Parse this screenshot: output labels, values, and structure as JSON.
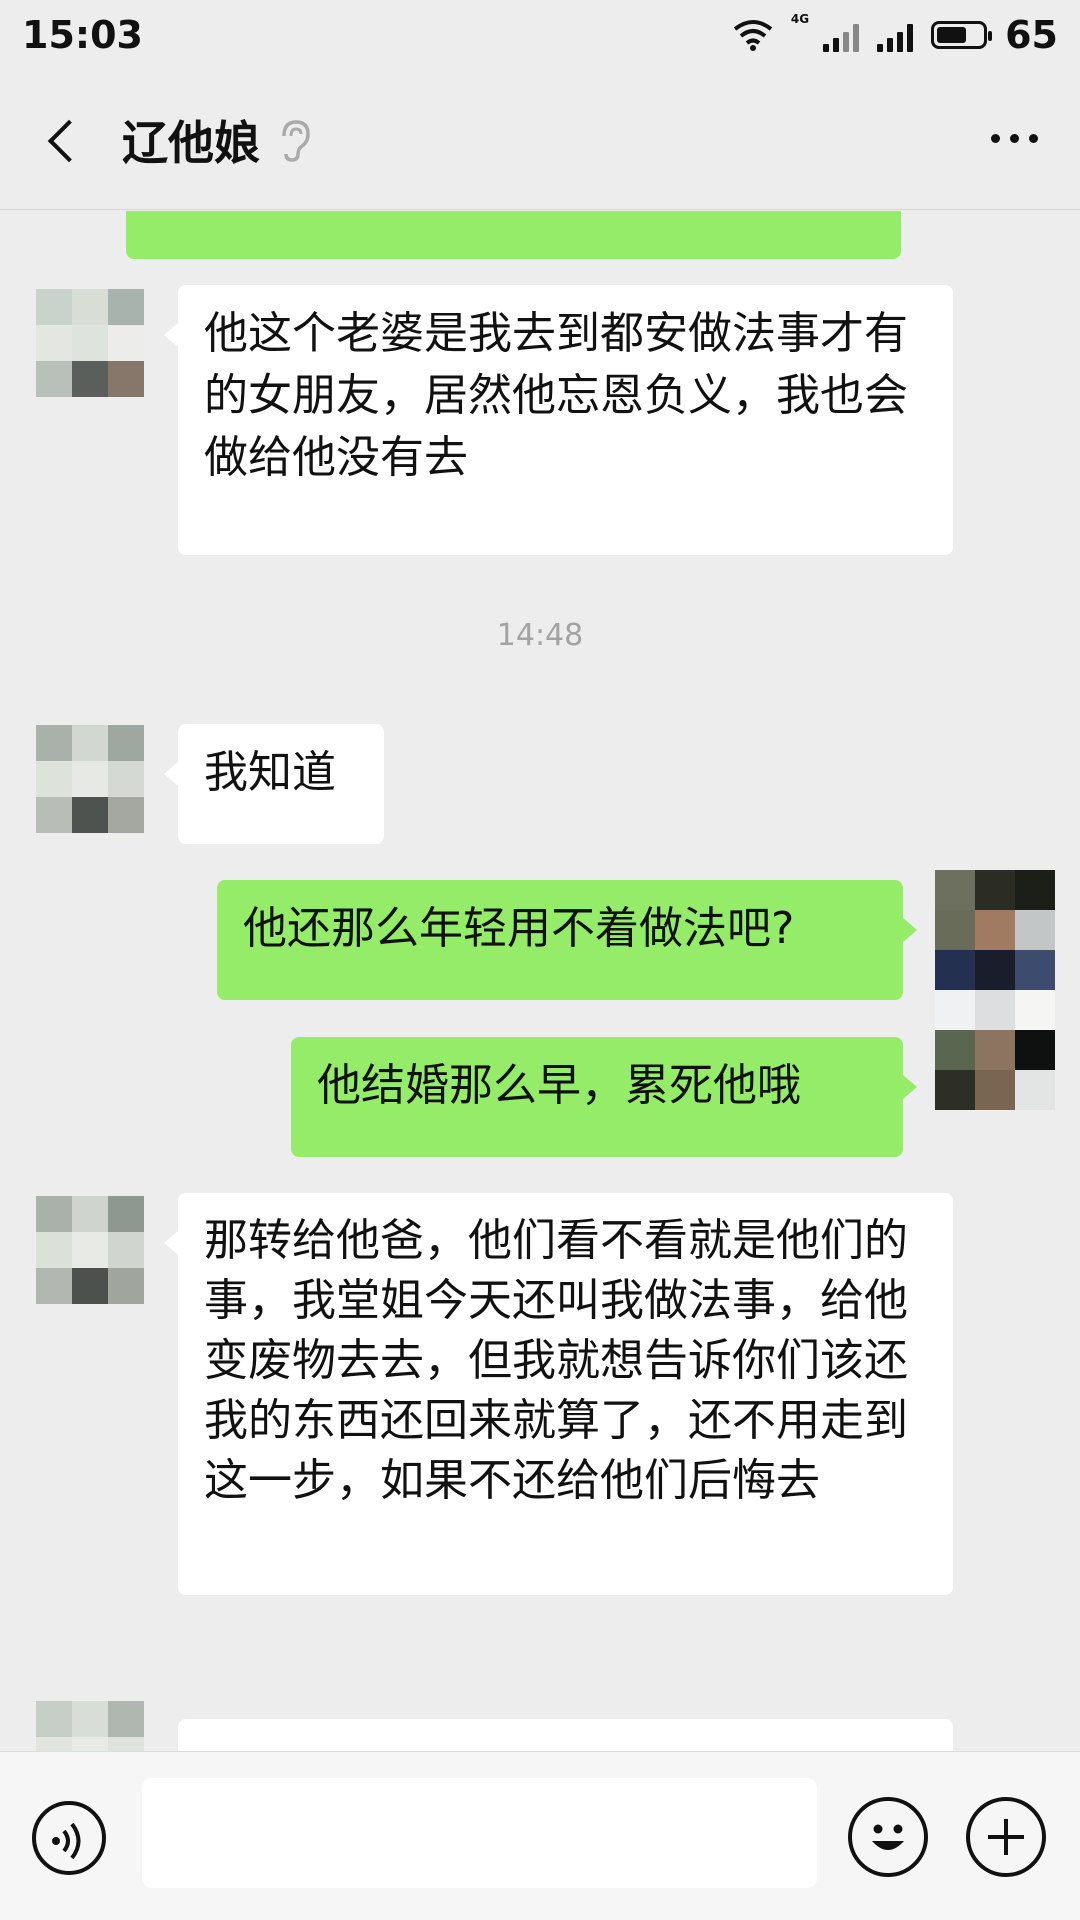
{
  "status_bar": {
    "time": "15:03",
    "network": "4G",
    "battery": "65",
    "battery_level": 0.65
  },
  "header": {
    "title": "辽他娘",
    "back_icon": "chevron-left-icon",
    "ear_icon": "ear-icon",
    "more_icon": "more-dots-icon"
  },
  "colors": {
    "background": "#ededed",
    "outgoing_bubble": "#95ec69",
    "incoming_bubble": "#ffffff"
  },
  "messages": [
    {
      "direction": "incoming",
      "text": "他这个老婆是我去到都安做法事才有的女朋友，居然他忘恩负义，我也会做给他没有去"
    },
    {
      "type": "timestamp",
      "text": "14:48"
    },
    {
      "direction": "incoming",
      "text": "我知道"
    },
    {
      "direction": "outgoing",
      "text": "他还那么年轻用不着做法吧?"
    },
    {
      "direction": "outgoing",
      "text": "他结婚那么早，累死他哦"
    },
    {
      "direction": "incoming",
      "text": "那转给他爸，他们看不看就是他们的事，我堂姐今天还叫我做法事，给他变废物去去，但我就想告诉你们该还我的东西还回来就算了，还不用走到这一步，如果不还给他们后悔去"
    }
  ],
  "input_bar": {
    "voice_icon": "voice-icon",
    "emoji_icon": "emoji-icon",
    "plus_icon": "plus-icon"
  }
}
